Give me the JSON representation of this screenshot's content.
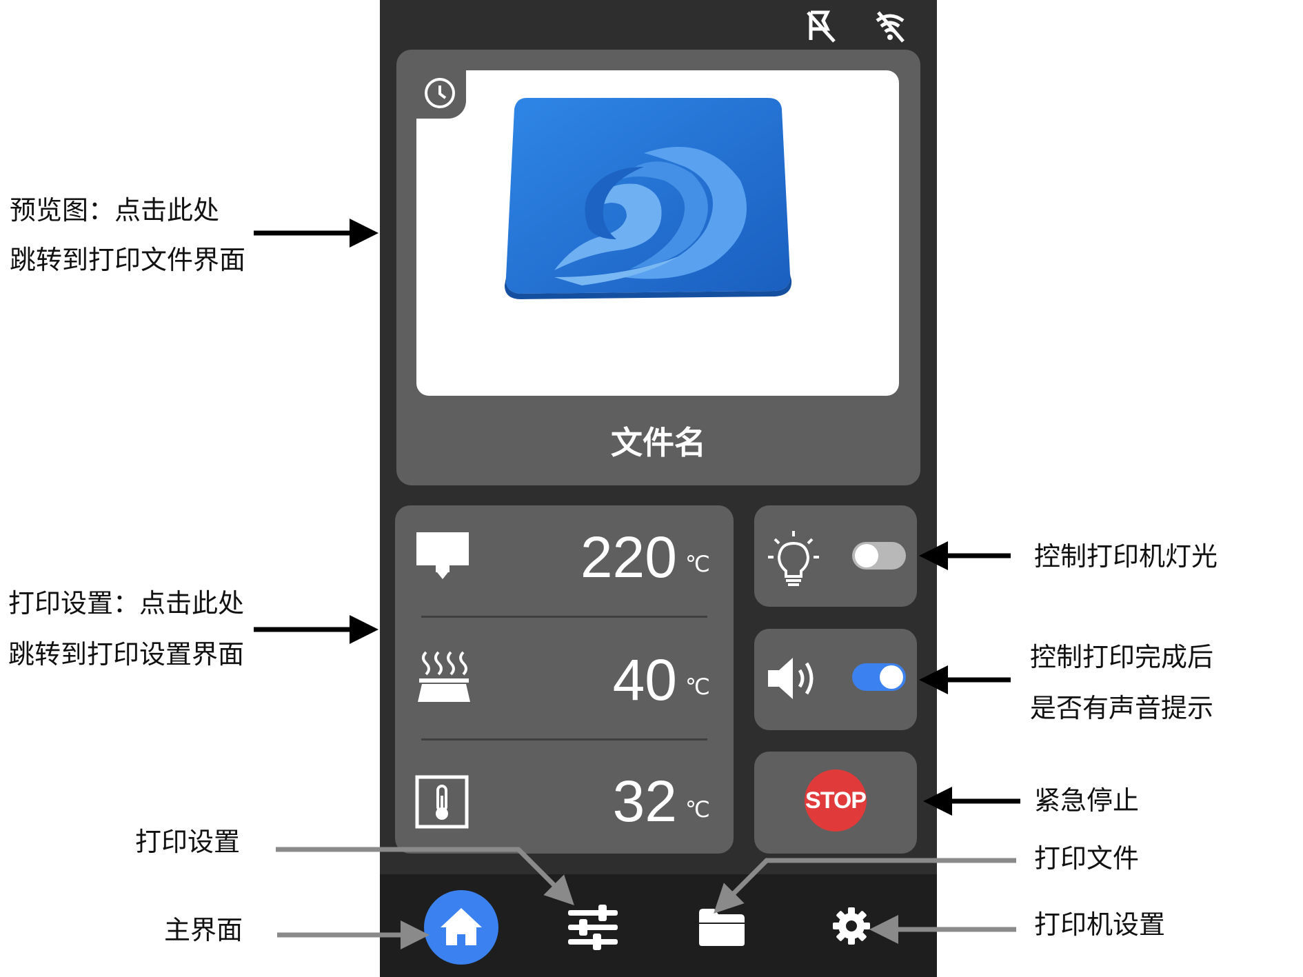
{
  "screen": {
    "file_name": "文件名",
    "temps": [
      {
        "value": "220",
        "unit": "℃",
        "icon": "nozzle-icon"
      },
      {
        "value": "40",
        "unit": "℃",
        "icon": "heated-bed-icon"
      },
      {
        "value": "32",
        "unit": "℃",
        "icon": "thermometer-icon"
      }
    ],
    "light_toggle_on": false,
    "sound_toggle_on": true,
    "stop_label": "STOP",
    "colors": {
      "accent": "#3b82f0",
      "stop": "#e03a3a",
      "panel": "#5f5f5f",
      "frame": "#2e2e2e",
      "preview_model": "#1e6fd0"
    }
  },
  "annotations": {
    "preview_line1": "预览图：点击此处",
    "preview_line2": "跳转到打印文件界面",
    "settings_line1": "打印设置：点击此处",
    "settings_line2": "跳转到打印设置界面",
    "light": "控制打印机灯光",
    "sound_line1": "控制打印完成后",
    "sound_line2": "是否有声音提示",
    "stop": "紧急停止",
    "print_settings": "打印设置",
    "home": "主界面",
    "print_files": "打印文件",
    "printer_settings": "打印机设置"
  }
}
